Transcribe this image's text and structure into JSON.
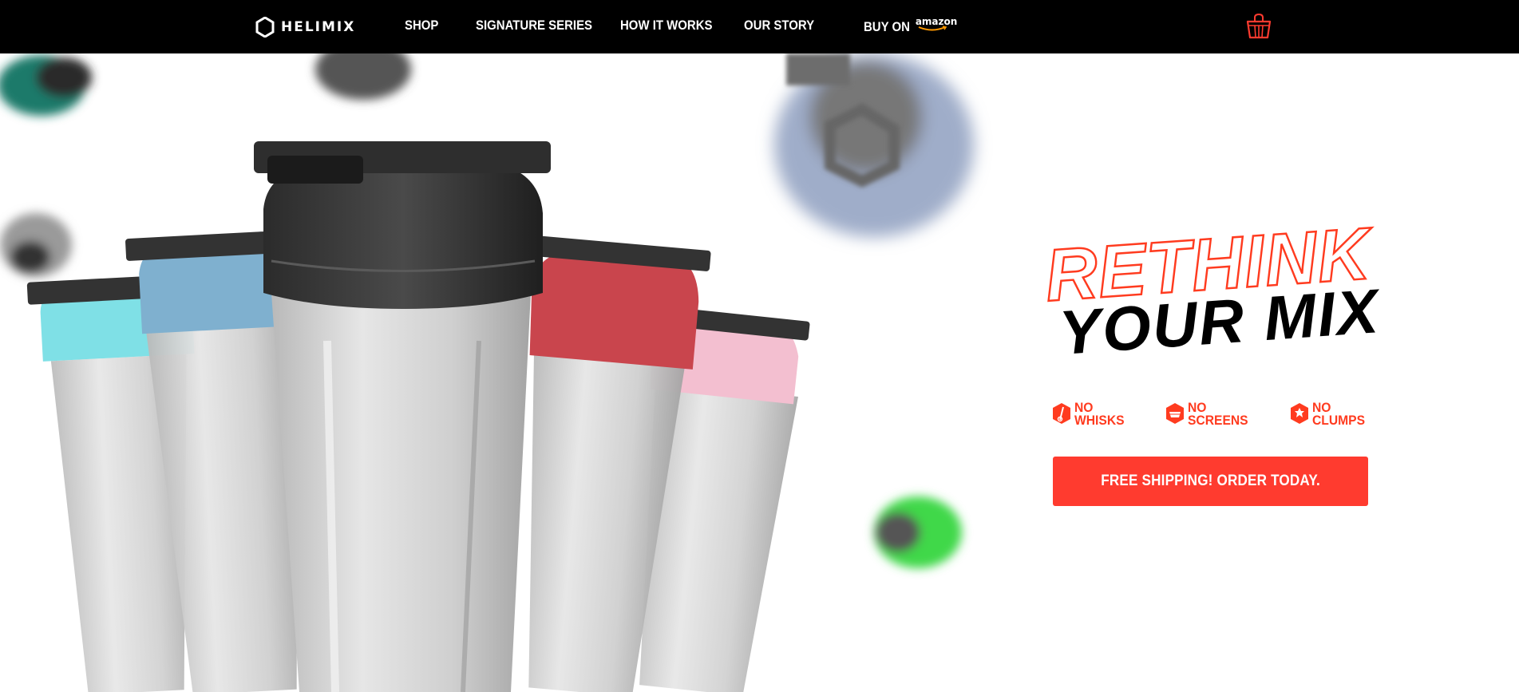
{
  "brand": {
    "name": "HELIMIX",
    "accent_color": "#ff3b1f",
    "nav_background": "#000000"
  },
  "nav": {
    "items": [
      {
        "label": "SHOP"
      },
      {
        "label": "SIGNATURE SERIES"
      },
      {
        "label": "HOW IT WORKS"
      },
      {
        "label": "OUR STORY"
      }
    ],
    "amazon": {
      "label": "BUY ON",
      "logo_text": "amazon"
    },
    "cart_icon": "basket-icon"
  },
  "hero": {
    "headline_line1": "RETHINK",
    "headline_line2": "YOUR MIX",
    "features": [
      {
        "line1": "NO",
        "line2": "WHISKS",
        "icon": "whisk-hexagon-icon"
      },
      {
        "line1": "NO",
        "line2": "SCREENS",
        "icon": "screen-hexagon-icon"
      },
      {
        "line1": "NO",
        "line2": "CLUMPS",
        "icon": "clump-hexagon-icon"
      }
    ],
    "cta_label": "FREE SHIPPING! ORDER TODAY.",
    "cta_color": "#ff3b2f",
    "bottle_colors": [
      "#7fe0e6",
      "#7fb0cf",
      "#3a3a3a",
      "#c9454d",
      "#f3bfd0"
    ]
  }
}
